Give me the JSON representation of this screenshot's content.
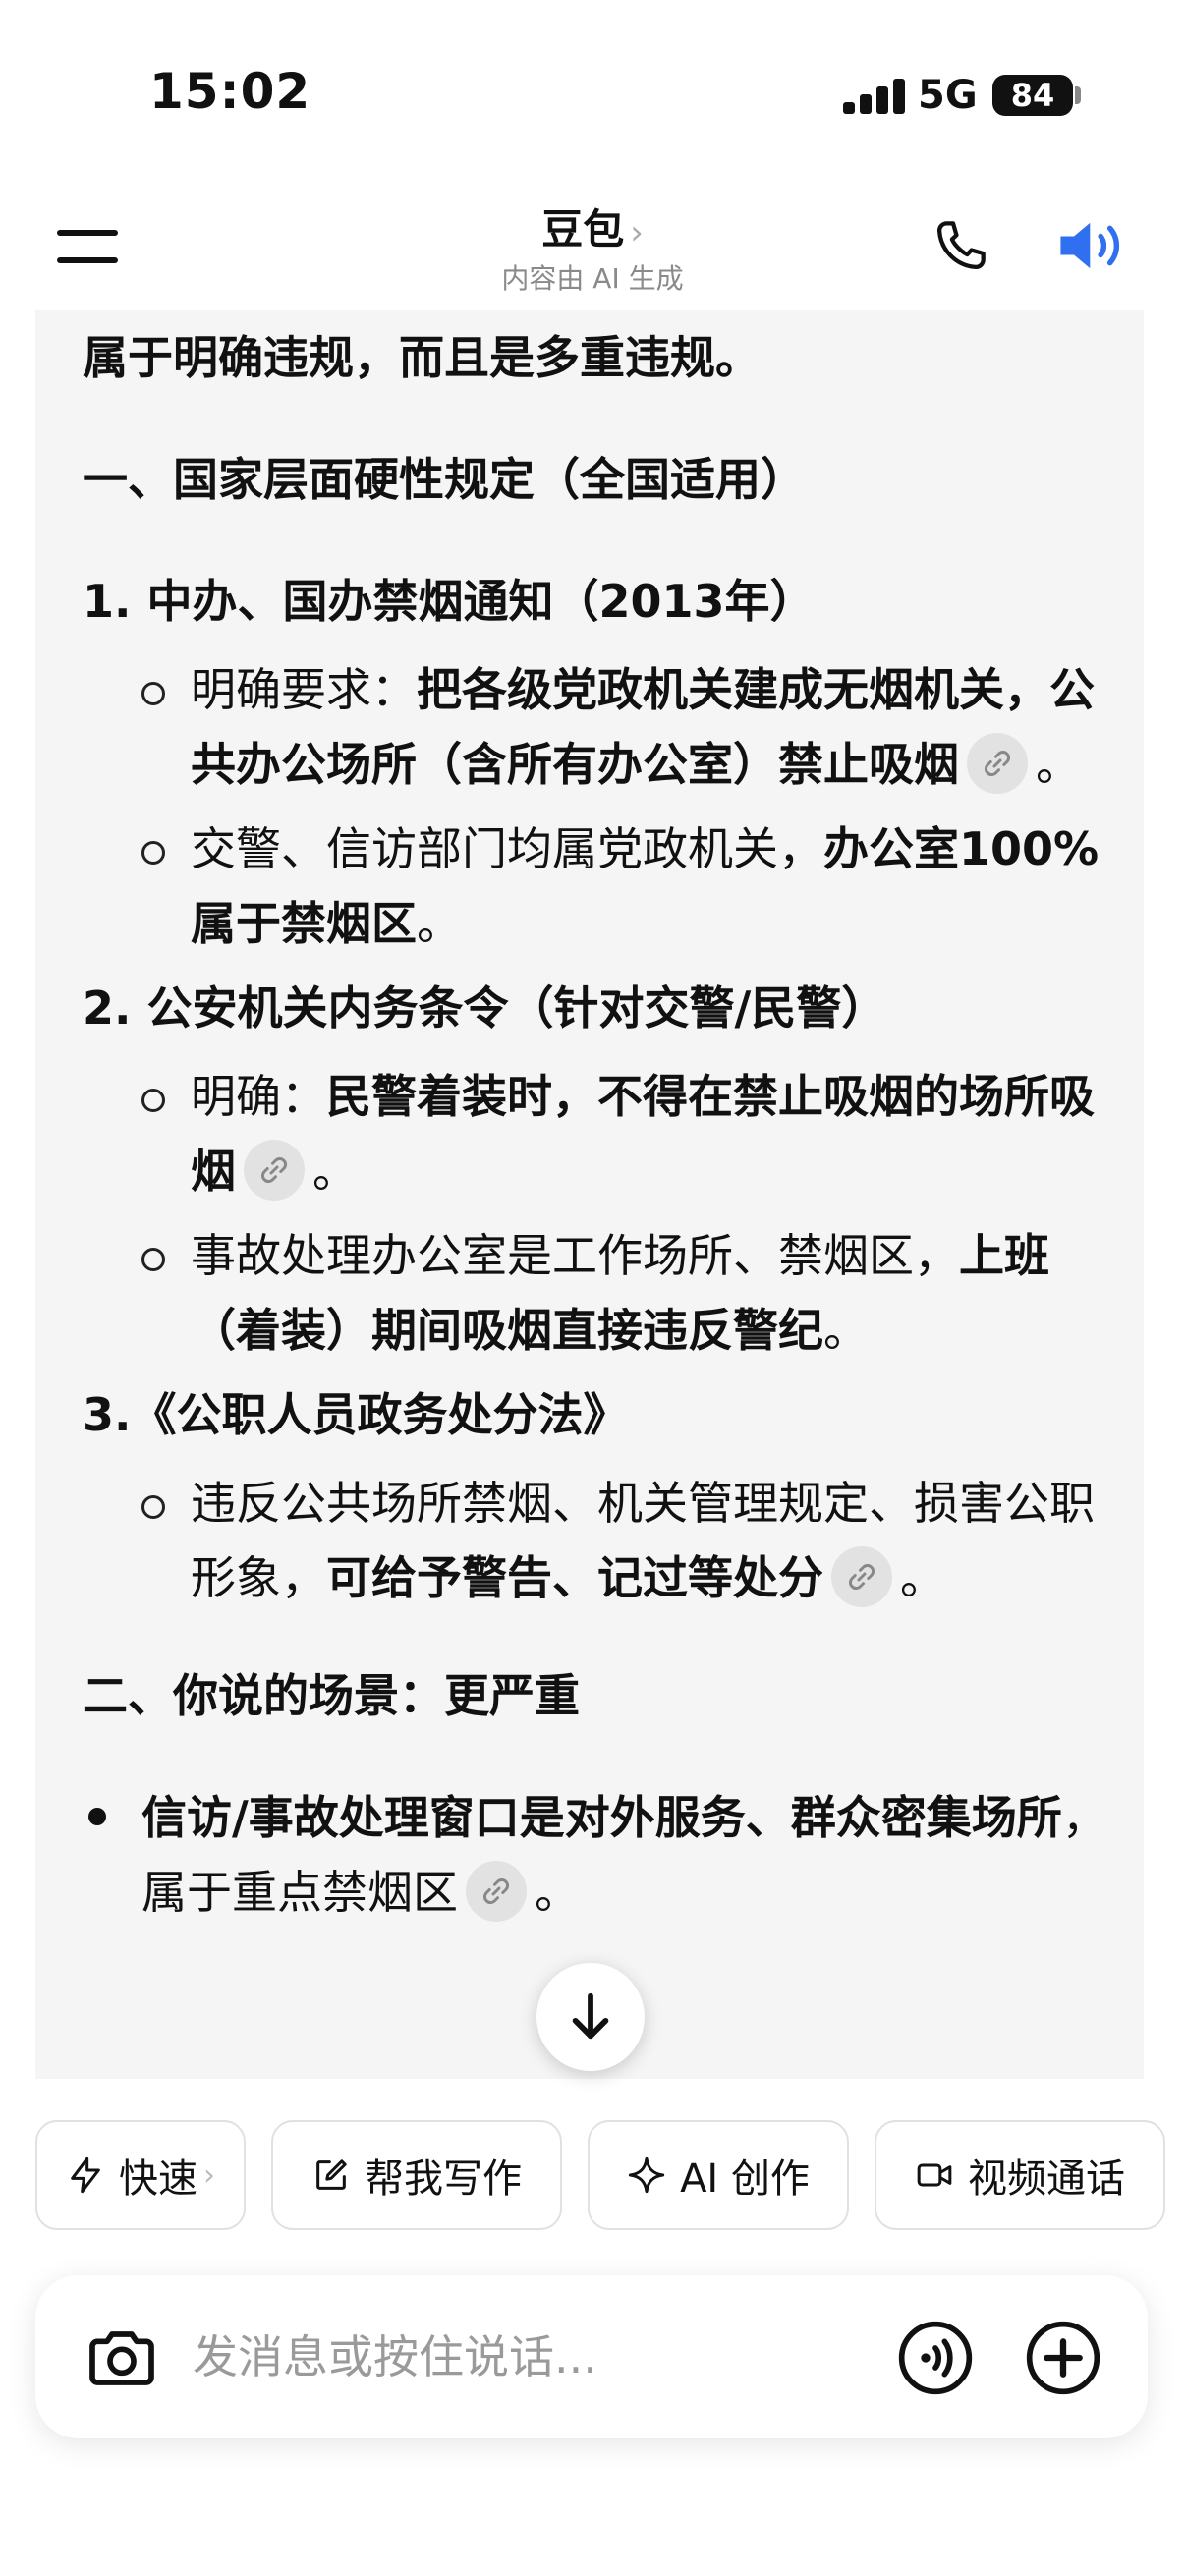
{
  "status_bar": {
    "time": "15:02",
    "network": "5G",
    "battery": "84"
  },
  "header": {
    "title": "豆包",
    "title_chevron": "›",
    "subtitle": "内容由 AI 生成"
  },
  "content": {
    "intro": "属于明确违规，而且是多重违规。",
    "section1_heading": "一、国家层面硬性规定（全国适用）",
    "item1": {
      "title": "1. 中办、国办禁烟通知（2013年）",
      "sub1_prefix": "明确要求：",
      "sub1_bold": "把各级党政机关建成无烟机关，公共办公场所（含所有办公室）禁止吸烟",
      "sub1_end": "。",
      "sub2_prefix": "交警、信访部门均属党政机关，",
      "sub2_bold": "办公室100%属于禁烟区",
      "sub2_end": "。"
    },
    "item2": {
      "title": "2. 公安机关内务条令（针对交警/民警）",
      "sub1_prefix": "明确：",
      "sub1_bold": "民警着装时，不得在禁止吸烟的场所吸烟",
      "sub1_end": "。",
      "sub2_prefix": "事故处理办公室是工作场所、禁烟区，",
      "sub2_bold": "上班（着装）期间吸烟直接违反警纪",
      "sub2_end": "。"
    },
    "item3": {
      "title": "3.《公职人员政务处分法》",
      "sub1_prefix": "违反公共场所禁烟、机关管理规定、损害公职形象，",
      "sub1_bold": "可给予警告、记过等处分",
      "sub1_end": "。"
    },
    "section2_heading": "二、你说的场景：更严重",
    "bullet1_bold": "信访/事故处理窗口是对外服务、群众密集场所",
    "bullet1_rest": "，属于重点禁烟区",
    "bullet1_end": "。"
  },
  "chips": {
    "quick": "快速",
    "quick_chevron": "›",
    "write": "帮我写作",
    "ai_create": "AI 创作",
    "video_call": "视频通话"
  },
  "input": {
    "placeholder": "发消息或按住说话..."
  },
  "icons": {
    "menu": "menu-icon",
    "phone": "phone-icon",
    "speaker": "speaker-icon",
    "link": "link-icon",
    "scroll_down": "arrow-down-icon",
    "quick": "lightning-icon",
    "write": "edit-icon",
    "ai_create": "sparkle-icon",
    "video": "video-camera-icon",
    "camera": "camera-icon",
    "voice": "voice-wave-icon",
    "plus": "plus-icon"
  },
  "colors": {
    "accent": "#2f6ff0",
    "card_bg": "#f5f5f5"
  }
}
